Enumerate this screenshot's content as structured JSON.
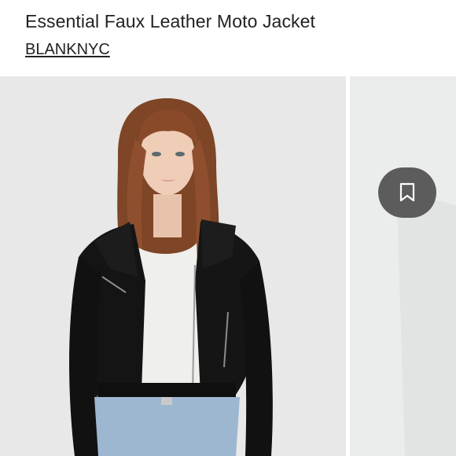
{
  "product": {
    "title": "Essential Faux Leather Moto Jacket",
    "brand": "BLANKNYC"
  },
  "gallery": {
    "main_image_alt": "Model wearing black faux leather moto jacket with white top and jeans",
    "bookmark_icon": "bookmark-icon",
    "bookmark_bg": "#5c5c5c"
  },
  "colors": {
    "text": "#222222",
    "photo_bg": "#e7e8e7",
    "jacket": "#141414",
    "hair": "#8a4a2a",
    "denim": "#9db7d0"
  }
}
